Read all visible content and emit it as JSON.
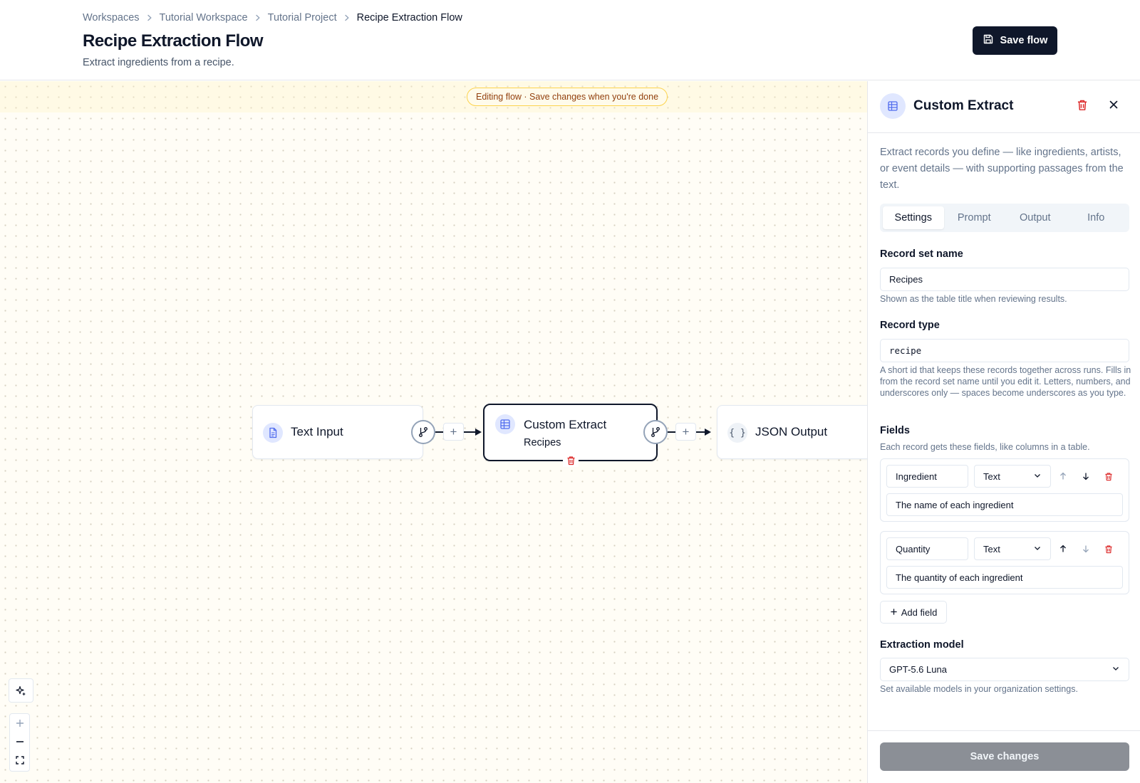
{
  "header": {
    "breadcrumb": [
      "Workspaces",
      "Tutorial Workspace",
      "Tutorial Project",
      "Recipe Extraction Flow"
    ],
    "title": "Recipe Extraction Flow",
    "subtitle": "Extract ingredients from a recipe.",
    "save_label": "Save flow"
  },
  "canvas": {
    "banner": "Editing flow · Save changes when you're done",
    "nodes": {
      "text_input": {
        "title": "Text Input",
        "icon": "document-icon"
      },
      "custom_extract": {
        "title": "Custom Extract",
        "subtitle": "Recipes",
        "icon": "table-icon"
      },
      "json_output": {
        "title": "JSON Output",
        "icon": "braces-icon"
      }
    },
    "controls": [
      "sparkle-icon",
      "zoom-in-icon",
      "zoom-out-icon",
      "fit-view-icon"
    ]
  },
  "panel": {
    "title": "Custom Extract",
    "description": "Extract records you define — like ingredients, artists, or event details — with supporting passages from the text.",
    "tabs": [
      "Settings",
      "Prompt",
      "Output",
      "Info"
    ],
    "active_tab": "Settings",
    "record_set": {
      "label": "Record set name",
      "value": "Recipes",
      "hint": "Shown as the table title when reviewing results."
    },
    "record_type": {
      "label": "Record type",
      "value": "recipe",
      "hint": "A short id that keeps these records together across runs. Fills in from the record set name until you edit it. Letters, numbers, and underscores only — spaces become underscores as you type."
    },
    "fields": {
      "label": "Fields",
      "hint": "Each record gets these fields, like columns in a table.",
      "items": [
        {
          "name": "Ingredient",
          "type": "Text",
          "description": "The name of each ingredient"
        },
        {
          "name": "Quantity",
          "type": "Text",
          "description": "The quantity of each ingredient"
        }
      ],
      "add_label": "Add field"
    },
    "model": {
      "label": "Extraction model",
      "value": "GPT-5.6 Luna",
      "hint": "Set available models in your organization settings."
    },
    "save_label": "Save changes"
  },
  "colors": {
    "primary": "#0f172a",
    "danger": "#dc2626",
    "accent": "#6366f1",
    "banner_bg": "#fffbeb",
    "canvas_bg": "#fffdf6"
  }
}
